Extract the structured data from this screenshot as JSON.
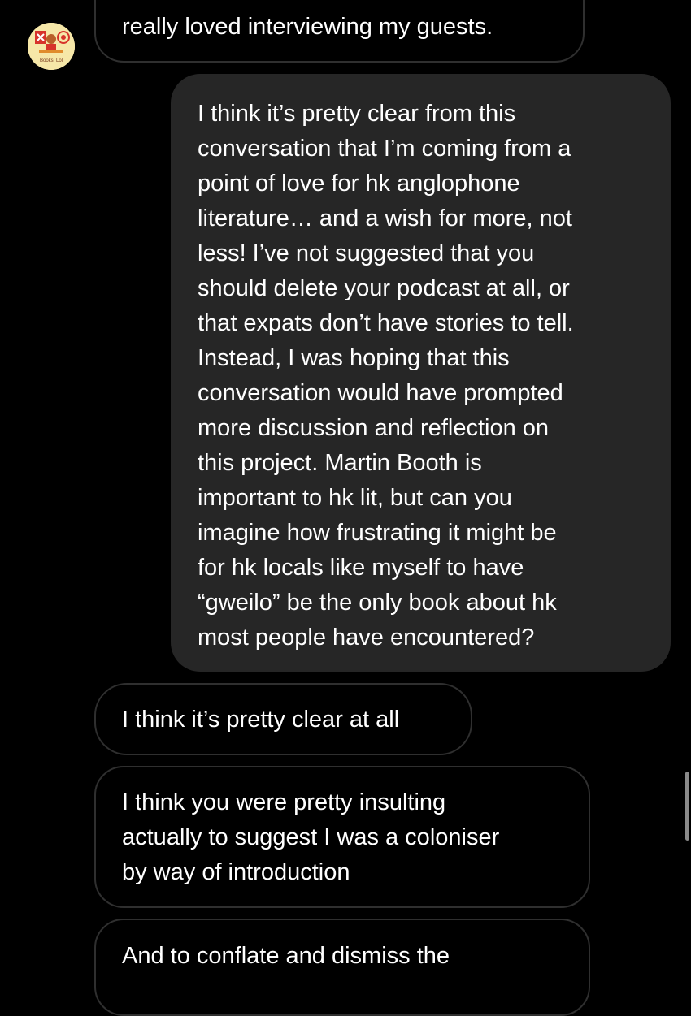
{
  "thread": {
    "avatar": {
      "icon": "books-lol-podcast-logo-icon",
      "logo_text": "Books, Lol",
      "background": "#f6e7a8",
      "accent": "#d7332b"
    },
    "messages": [
      {
        "sender": "them",
        "lines": [
          "really loved interviewing my guests."
        ]
      },
      {
        "sender": "me",
        "lines": [
          "I think it’s pretty clear from this",
          "conversation that I’m coming from a",
          "point of love for hk anglophone",
          "literature… and a wish for more, not",
          "less! I’ve not suggested that you",
          "should delete your podcast at all, or",
          "that expats don’t have stories to tell.",
          "Instead, I was hoping that this",
          "conversation would have prompted",
          "more discussion and reflection on",
          "this project. Martin Booth is",
          "important to hk lit, but can you",
          "imagine how frustrating it might be",
          "for hk locals like myself to have",
          "“gweilo” be the only book about hk",
          "most people have encountered?"
        ]
      },
      {
        "sender": "them",
        "lines": [
          "I think it’s pretty clear at all"
        ]
      },
      {
        "sender": "them",
        "lines": [
          "I think you were pretty insulting",
          "actually to suggest I was a coloniser",
          "by way of introduction"
        ]
      },
      {
        "sender": "them",
        "lines": [
          "And to conflate and dismiss the"
        ]
      }
    ]
  },
  "colors": {
    "background": "#000000",
    "incoming_border": "#2f2f2f",
    "outgoing_bubble": "#262626",
    "text": "#ffffff",
    "scrollbar": "#8a8a8a"
  }
}
